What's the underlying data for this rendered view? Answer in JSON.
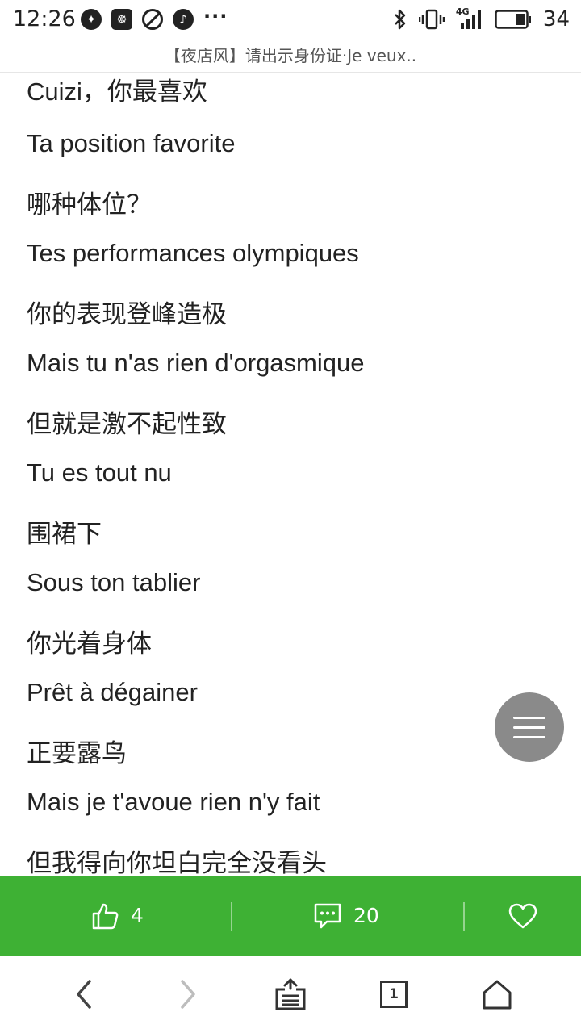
{
  "status_bar": {
    "time": "12:26",
    "network": "4G",
    "battery": "34",
    "more": "···"
  },
  "page": {
    "title": "【夜店风】请出示身份证·Je veux.."
  },
  "lyrics": [
    "Cuizi，你最喜欢",
    "Ta position favorite",
    "哪种体位？",
    "Tes performances olympiques",
    "你的表现登峰造极",
    "Mais tu n'as rien d'orgasmique",
    "但就是激不起性致",
    "Tu es tout nu",
    "围裙下",
    "Sous ton tablier",
    "你光着身体",
    "Prêt à dégainer",
    "正要露鸟",
    "Mais je t'avoue rien n'y fait",
    "但我得向你坦白完全没看头"
  ],
  "actions": {
    "likes": "4",
    "comments": "20",
    "accent_color": "#3eb134"
  },
  "nav": {
    "tab_count": "1"
  }
}
